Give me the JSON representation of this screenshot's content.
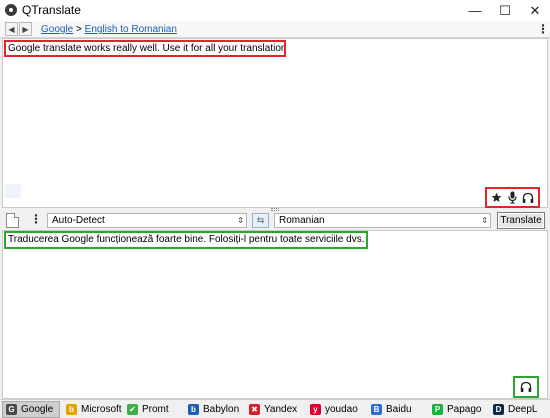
{
  "window": {
    "title": "QTranslate",
    "minimize_glyph": "—",
    "maximize_glyph": "☐",
    "close_glyph": "✕"
  },
  "nav": {
    "back_glyph": "◀",
    "forward_glyph": "▶",
    "service_link": "Google",
    "separator": ">",
    "direction_link": "English to Romanian",
    "menu_glyph": "⋮"
  },
  "source": {
    "text": "Google translate works really well. Use it for all your translation services",
    "icons": [
      "star-icon",
      "microphone-icon",
      "headphones-icon"
    ],
    "highlight_color": "#e0262a"
  },
  "toolbar": {
    "menu_glyph": "⋮",
    "source_language": "Auto-Detect",
    "swap_glyph": "⇆",
    "target_language": "Romanian",
    "caret_glyph": "⇕",
    "translate_label": "Translate"
  },
  "target": {
    "text": "Traducerea Google funcționează foarte bine. Folosiți-l pentru toate serviciile dvs. de traducere",
    "icons": [
      "headphones-icon"
    ],
    "highlight_color": "#2aa631"
  },
  "services": [
    {
      "label": "Google",
      "icon": "G",
      "color": "#4a4a4a",
      "active": true
    },
    {
      "label": "Microsoft",
      "icon": "b",
      "color": "#e5a000",
      "active": false
    },
    {
      "label": "Promt",
      "icon": "✔",
      "color": "#3fae49",
      "active": false
    },
    {
      "label": "Babylon",
      "icon": "b",
      "color": "#1a5fb4",
      "active": false
    },
    {
      "label": "Yandex",
      "icon": "✖",
      "color": "#d4202a",
      "active": false
    },
    {
      "label": "youdao",
      "icon": "y",
      "color": "#e4002b",
      "active": false
    },
    {
      "label": "Baidu",
      "icon": "B",
      "color": "#2f6cd6",
      "active": false
    },
    {
      "label": "Papago",
      "icon": "P",
      "color": "#14b53c",
      "active": false
    },
    {
      "label": "DeepL",
      "icon": "D",
      "color": "#0f2b46",
      "active": false
    }
  ]
}
